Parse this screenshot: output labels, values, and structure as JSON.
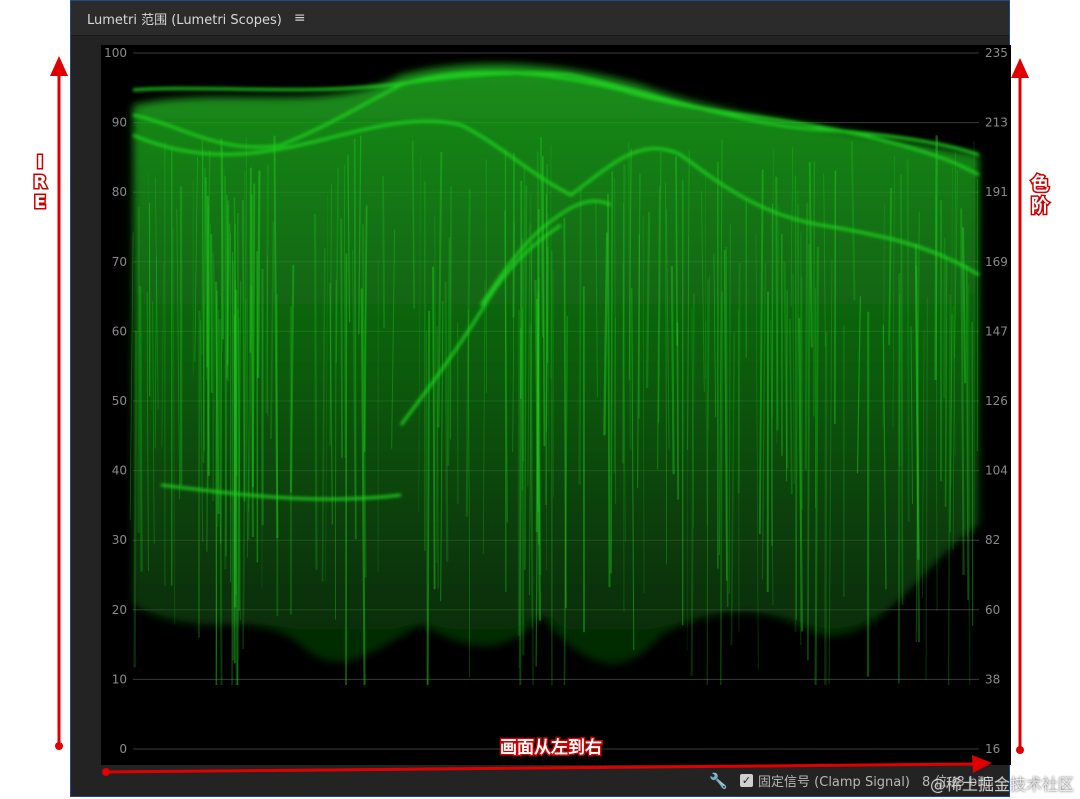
{
  "panel": {
    "title": "Lumetri 范围 (Lumetri Scopes)",
    "menu_icon": "hamburger-icon"
  },
  "scope": {
    "type": "waveform",
    "left_axis_ticks": [
      "100",
      "90",
      "80",
      "70",
      "60",
      "50",
      "40",
      "30",
      "20",
      "10",
      "0"
    ],
    "right_axis_ticks": [
      "235",
      "213",
      "191",
      "169",
      "147",
      "126",
      "104",
      "82",
      "60",
      "38",
      "16"
    ],
    "trace_color": "#1fd11f"
  },
  "footer": {
    "settings_icon": "wrench-icon",
    "clamp_checked": true,
    "clamp_label": "固定信号 (Clamp Signal)",
    "bit_depth": "8 位 (8 bit)"
  },
  "annotations": {
    "left_label": [
      "I",
      "R",
      "E"
    ],
    "right_label": [
      "色",
      "阶"
    ],
    "bottom_label": "画面从左到右",
    "color": "#e00000"
  },
  "watermark": "@稀土掘金技术社区"
}
